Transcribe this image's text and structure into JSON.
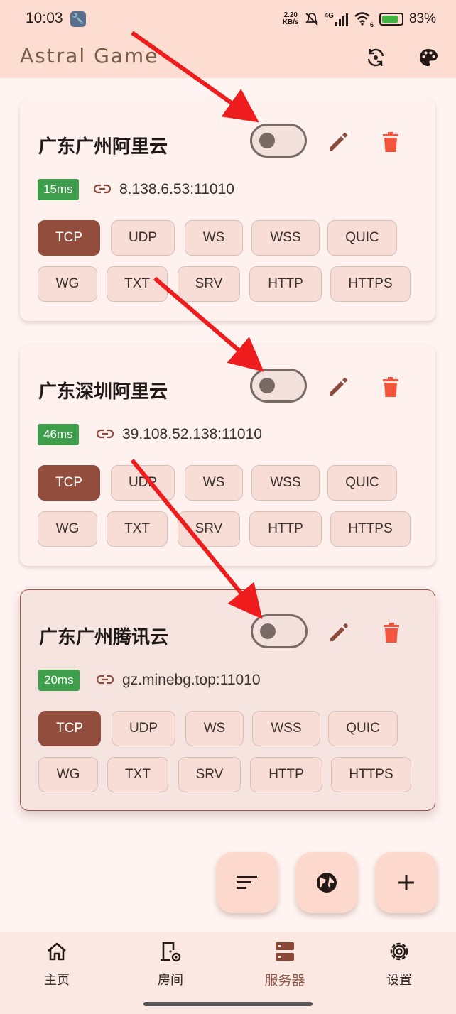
{
  "status_bar": {
    "time": "10:03",
    "net_speed_top": "2.20",
    "net_speed_unit": "KB/s",
    "signal_label": "4G",
    "wifi_index": "6",
    "battery": "83%",
    "battery_level": 0.83
  },
  "app_bar": {
    "title": "Astral Game",
    "icon_right_1": "rotate-icon",
    "icon_right_2": "palette-icon"
  },
  "servers": [
    {
      "name": "广东广州阿里云",
      "latency": "15ms",
      "address": "8.138.6.53:11010",
      "enabled": false,
      "selected": false,
      "protocols": [
        "TCP",
        "UDP",
        "WS",
        "WSS",
        "QUIC",
        "WG",
        "TXT",
        "SRV",
        "HTTP",
        "HTTPS"
      ],
      "active_protocol": "TCP"
    },
    {
      "name": "广东深圳阿里云",
      "latency": "46ms",
      "address": "39.108.52.138:11010",
      "enabled": false,
      "selected": false,
      "protocols": [
        "TCP",
        "UDP",
        "WS",
        "WSS",
        "QUIC",
        "WG",
        "TXT",
        "SRV",
        "HTTP",
        "HTTPS"
      ],
      "active_protocol": "TCP"
    },
    {
      "name": "广东广州腾讯云",
      "latency": "20ms",
      "address": "gz.minebg.top:11010",
      "enabled": false,
      "selected": true,
      "protocols": [
        "TCP",
        "UDP",
        "WS",
        "WSS",
        "QUIC",
        "WG",
        "TXT",
        "SRV",
        "HTTP",
        "HTTPS"
      ],
      "active_protocol": "TCP"
    }
  ],
  "fabs": {
    "sort": "sort-icon",
    "globe": "globe-icon",
    "add": "add-icon"
  },
  "nav": [
    {
      "label": "主页",
      "icon": "home-icon"
    },
    {
      "label": "房间",
      "icon": "room-icon"
    },
    {
      "label": "服务器",
      "icon": "server-icon",
      "active": true
    },
    {
      "label": "设置",
      "icon": "settings-icon"
    }
  ],
  "colors": {
    "accent": "#934d3c",
    "latency_badge": "#3f9e4c",
    "delete": "#f2543d",
    "appbar": "#fddcd1"
  }
}
